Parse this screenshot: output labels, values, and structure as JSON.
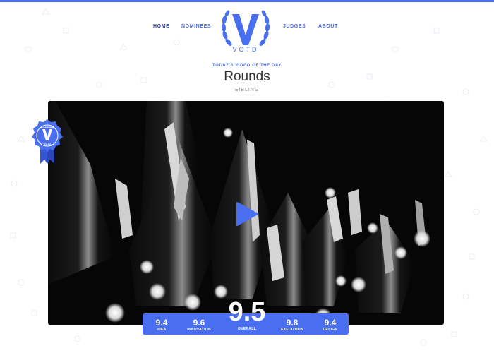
{
  "nav": {
    "home": "HOME",
    "nominees": "NOMINEES",
    "judges": "JUDGES",
    "about": "ABOUT"
  },
  "brand": {
    "logo_text": "VOTD",
    "accent_color": "#4a6ef0"
  },
  "header": {
    "kicker": "TODAY'S VIDEO OF THE DAY",
    "title": "Rounds",
    "subtitle": "SIBLING"
  },
  "badge": {
    "text": "NOMINEE VOTD",
    "icon": "nominee-ribbon-icon"
  },
  "video": {
    "play_icon": "play-icon"
  },
  "scores": {
    "idea": {
      "value": "9.4",
      "label": "IDEA"
    },
    "innovation": {
      "value": "9.6",
      "label": "INNOVATION"
    },
    "overall": {
      "value": "9.5",
      "label": "OVERALL"
    },
    "execution": {
      "value": "9.8",
      "label": "EXECUTION"
    },
    "design": {
      "value": "9.4",
      "label": "DESIGN"
    }
  }
}
